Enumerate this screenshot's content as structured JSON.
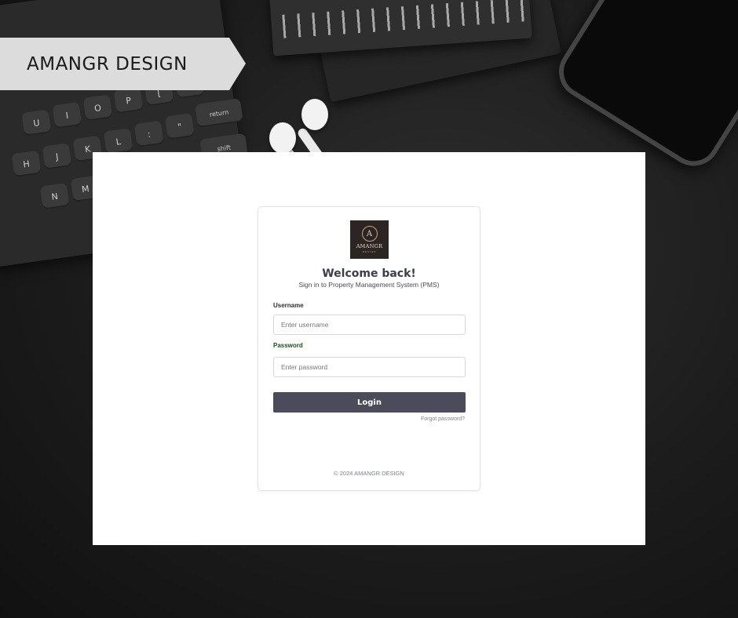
{
  "banner": {
    "text": "AMANGR DESIGN"
  },
  "keyboard": {
    "keys": [
      "U",
      "I",
      "O",
      "P",
      "[",
      "]",
      "H",
      "J",
      "K",
      "L",
      ":",
      "\"",
      "N",
      "M",
      "?",
      "return",
      "shift"
    ]
  },
  "login_card": {
    "logo": {
      "monogram": "A",
      "text": "AMANGR",
      "sub": "DESIGN"
    },
    "title": "Welcome back!",
    "subtitle": "Sign in to Property Management  System (PMS)",
    "username": {
      "label": "Username",
      "placeholder": "Enter username",
      "value": ""
    },
    "password": {
      "label": "Password",
      "placeholder": "Enter password",
      "value": ""
    },
    "login_label": "Login",
    "forgot_label": "Forgot password?",
    "footer": "©  2024 AMANGR DESIGN"
  },
  "colors": {
    "button": "#4b4b59",
    "title": "#3b3d4a",
    "link": "#7d7f95",
    "password_label": "#1f4a1f"
  }
}
